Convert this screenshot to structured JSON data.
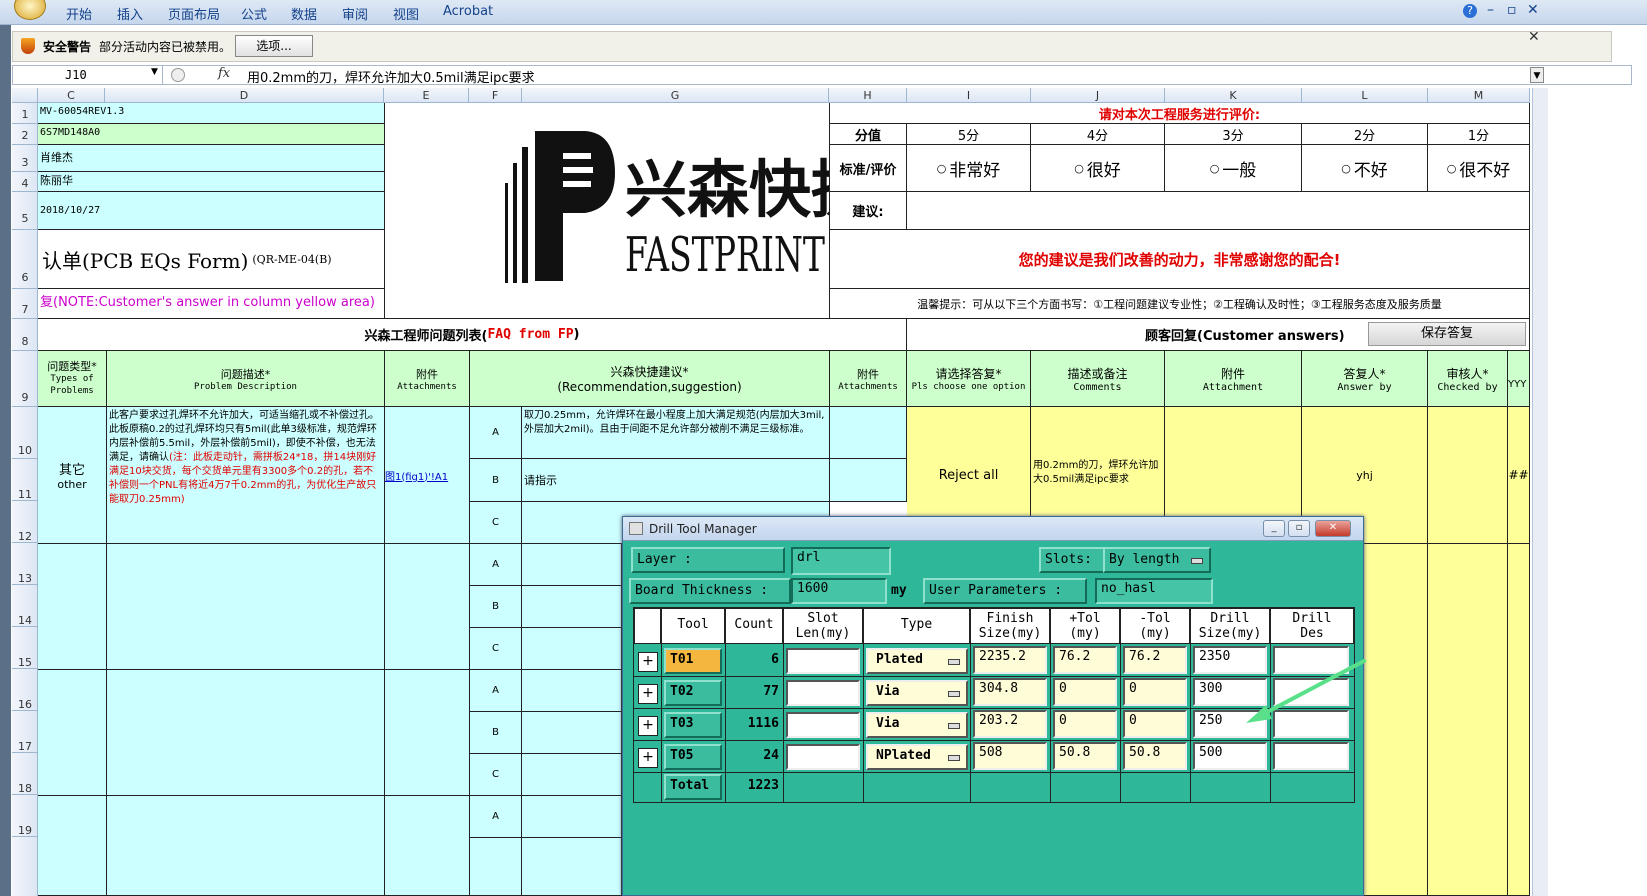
{
  "ribbon": {
    "menus": [
      "开始",
      "插入",
      "页面布局",
      "公式",
      "数据",
      "审阅",
      "视图",
      "Acrobat"
    ],
    "help": "?",
    "minimize": "–",
    "restore": "▫",
    "close": "✕"
  },
  "security": {
    "title": "安全警告",
    "message": "部分活动内容已被禁用。",
    "options_button": "选项...",
    "close": "✕"
  },
  "formula_bar": {
    "cell_ref": "J10",
    "fx": "fx",
    "formula": "用0.2mm的刀，焊环允许加大0.5mil满足ipc要求"
  },
  "columns": [
    "C",
    "D",
    "E",
    "F",
    "G",
    "H",
    "I",
    "J",
    "K",
    "L",
    "M"
  ],
  "rows": [
    "1",
    "2",
    "3",
    "4",
    "5",
    "6",
    "7",
    "8",
    "9",
    "10",
    "11",
    "12",
    "13",
    "14",
    "15",
    "16",
    "17",
    "18",
    "19"
  ],
  "sheet": {
    "c1": "MV-60054REV1.3",
    "c2": "6S7MD148A0",
    "c3": "肖维杰",
    "c4": "陈丽华",
    "c5": "2018/10/27",
    "form_title": "认单(PCB EQs Form)",
    "form_code": "(QR-ME-04(B)",
    "note": "复(NOTE:Customer's answer in column yellow area)",
    "logo_cn": "兴森快捷",
    "logo_en": "FASTPRINT",
    "eval_title": "请对本次工程服务进行评价:",
    "score_label": "分值",
    "scores": [
      "5分",
      "4分",
      "3分",
      "2分",
      "1分"
    ],
    "std_label": "标准/评价",
    "ratings": [
      "非常好",
      "很好",
      "一般",
      "不好",
      "很不好"
    ],
    "suggest_label": "建议:",
    "thanks": "您的建议是我们改善的动力，非常感谢您的配合!",
    "tips": "温馨提示：可从以下三个方面书写：①工程问题建议专业性；②工程确认及时性；③工程服务态度及服务质量",
    "faq_title_cn": "兴森工程师问题列表(",
    "faq_title_en": "FAQ from FP",
    "faq_title_end": ")",
    "cust_title": "顾客回复(Customer answers)",
    "save_button": "保存答复",
    "h_type_cn": "问题类型*",
    "h_type_en": "Types of Problems",
    "h_desc_cn": "问题描述*",
    "h_desc_en": "Problem Description",
    "h_att_cn": "附件",
    "h_att_en": "Attachments",
    "h_sugg_cn": "兴森快捷建议*",
    "h_sugg_en": "(Recommendation,suggestion)",
    "h_att2_cn": "附件",
    "h_att2_en": "Attachments",
    "h_choose_cn": "请选择答复*",
    "h_choose_en": "Pls choose one option",
    "h_comm_cn": "描述或备注",
    "h_comm_en": "Comments",
    "h_att3_cn": "附件",
    "h_att3_en": "Attachment",
    "h_ans_cn": "答复人*",
    "h_ans_en": "Answer by",
    "h_chk_cn": "审核人*",
    "h_chk_en": "Checked by",
    "h_yyy": "YYY",
    "type_cn": "其它",
    "type_en": "other",
    "desc_black": "此客户要求过孔焊环不允许加大，可适当缩孔或不补偿过孔。此板原稿0.2的过孔焊环均只有5mil(此单3级标准，规范焊环内层补偿前5.5mil，外层补偿前5mil)，即使不补偿，也无法满足，请确认",
    "desc_red": "(注：此板走动针，需拼板24*18，拼14块刚好满足10块交货，每个交货单元里有3300多个0.2的孔，若不补偿则一个PNL有将近4万7千0.2mm的孔，为优化生产故只能取刀0.25mm)",
    "attach_link": "图1(fig1)'!A1",
    "opt_a": "A",
    "opt_b": "B",
    "opt_c": "C",
    "sugg_a": "取刀0.25mm，允许焊环在最小程度上加大满足规范(内层加大3mil,外层加大2mil)。且由于间距不足允许部分被削不满足三级标准。",
    "sugg_b": "请指示",
    "answer": "Reject all",
    "comment": "用0.2mm的刀，焊环允许加大0.5mil满足ipc要求",
    "answer_by": "yhj",
    "hash": "##"
  },
  "drill": {
    "title": "Drill Tool Manager",
    "layer_label": "Layer          :",
    "layer_value": "drl",
    "slots_label": "Slots:",
    "slots_value": "By length",
    "thickness_label": "Board Thickness :",
    "thickness_value": "1600",
    "thickness_unit": "my",
    "user_params_label": "User Parameters :",
    "user_params_value": "no_hasl",
    "headers": {
      "tool": "Tool",
      "count": "Count",
      "slot": "Slot Len(my)",
      "type": "Type",
      "finish": "Finish Size(my)",
      "ptol": "+Tol (my)",
      "mtol": "-Tol (my)",
      "drill": "Drill Size(my)",
      "des": "Drill Des"
    },
    "rows": [
      {
        "tool": "T01",
        "count": "6",
        "type": "Plated",
        "finish": "2235.2",
        "ptol": "76.2",
        "mtol": "76.2",
        "drill": "2350"
      },
      {
        "tool": "T02",
        "count": "77",
        "type": "Via",
        "finish": "304.8",
        "ptol": "0",
        "mtol": "0",
        "drill": "300"
      },
      {
        "tool": "T03",
        "count": "1116",
        "type": "Via",
        "finish": "203.2",
        "ptol": "0",
        "mtol": "0",
        "drill": "250"
      },
      {
        "tool": "T05",
        "count": "24",
        "type": "NPlated",
        "finish": "508",
        "ptol": "50.8",
        "mtol": "50.8",
        "drill": "500"
      }
    ],
    "total_label": "Total",
    "total_count": "1223"
  },
  "colors": {
    "cyan": "#ccffff",
    "light_green": "#ccffcc",
    "yellow": "#ffff99",
    "drill_bg": "#2fb79a",
    "red": "#e00000"
  }
}
